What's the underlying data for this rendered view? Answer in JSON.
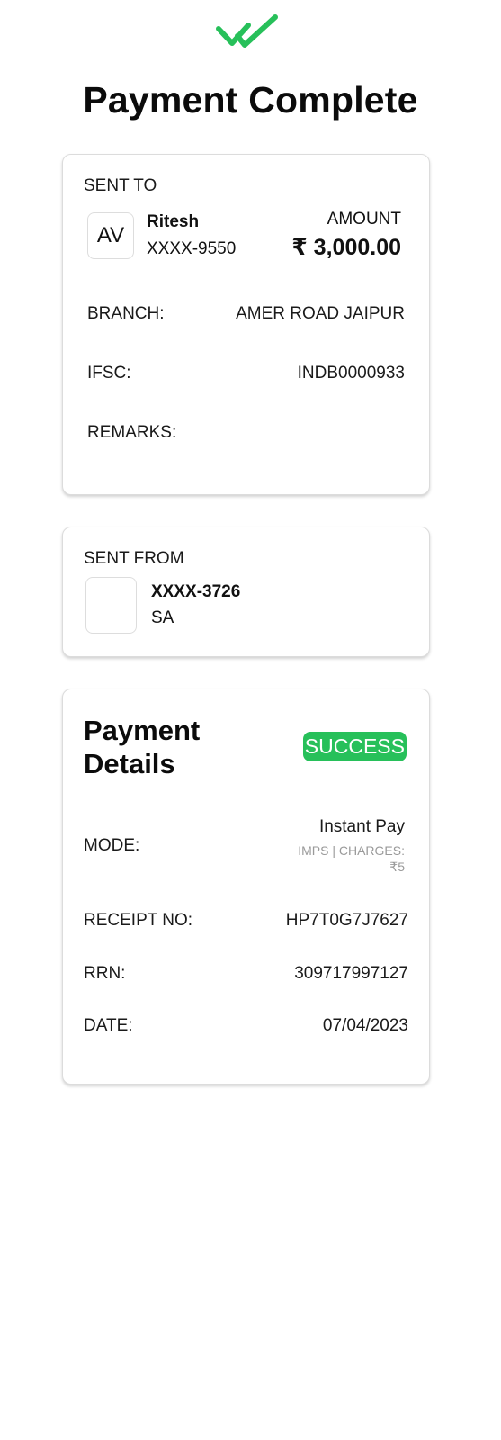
{
  "header": {
    "icon": "double-check-icon",
    "accent_color": "#27c05a",
    "title": "Payment Complete"
  },
  "sent_to": {
    "section_label": "SENT TO",
    "avatar_initials": "AV",
    "recipient_name": "Ritesh",
    "recipient_account": "XXXX-9550",
    "amount_label": "AMOUNT",
    "amount_value": "₹ 3,000.00",
    "branch_label": "BRANCH:",
    "branch_value": "AMER ROAD JAIPUR",
    "ifsc_label": "IFSC:",
    "ifsc_value": "INDB0000933",
    "remarks_label": "REMARKS:",
    "remarks_value": ""
  },
  "sent_from": {
    "section_label": "SENT FROM",
    "account": "XXXX-3726",
    "account_type": "SA"
  },
  "payment_details": {
    "title": "Payment Details",
    "status": "SUCCESS",
    "status_color": "#27c05a",
    "mode_label": "MODE:",
    "mode_value": "Instant Pay",
    "mode_sub_line1": "IMPS | CHARGES:",
    "mode_sub_line2": "₹5",
    "receipt_label": "RECEIPT NO:",
    "receipt_value": "HP7T0G7J7627",
    "rrn_label": "RRN:",
    "rrn_value": "309717997127",
    "date_label": "DATE:",
    "date_value": "07/04/2023"
  }
}
